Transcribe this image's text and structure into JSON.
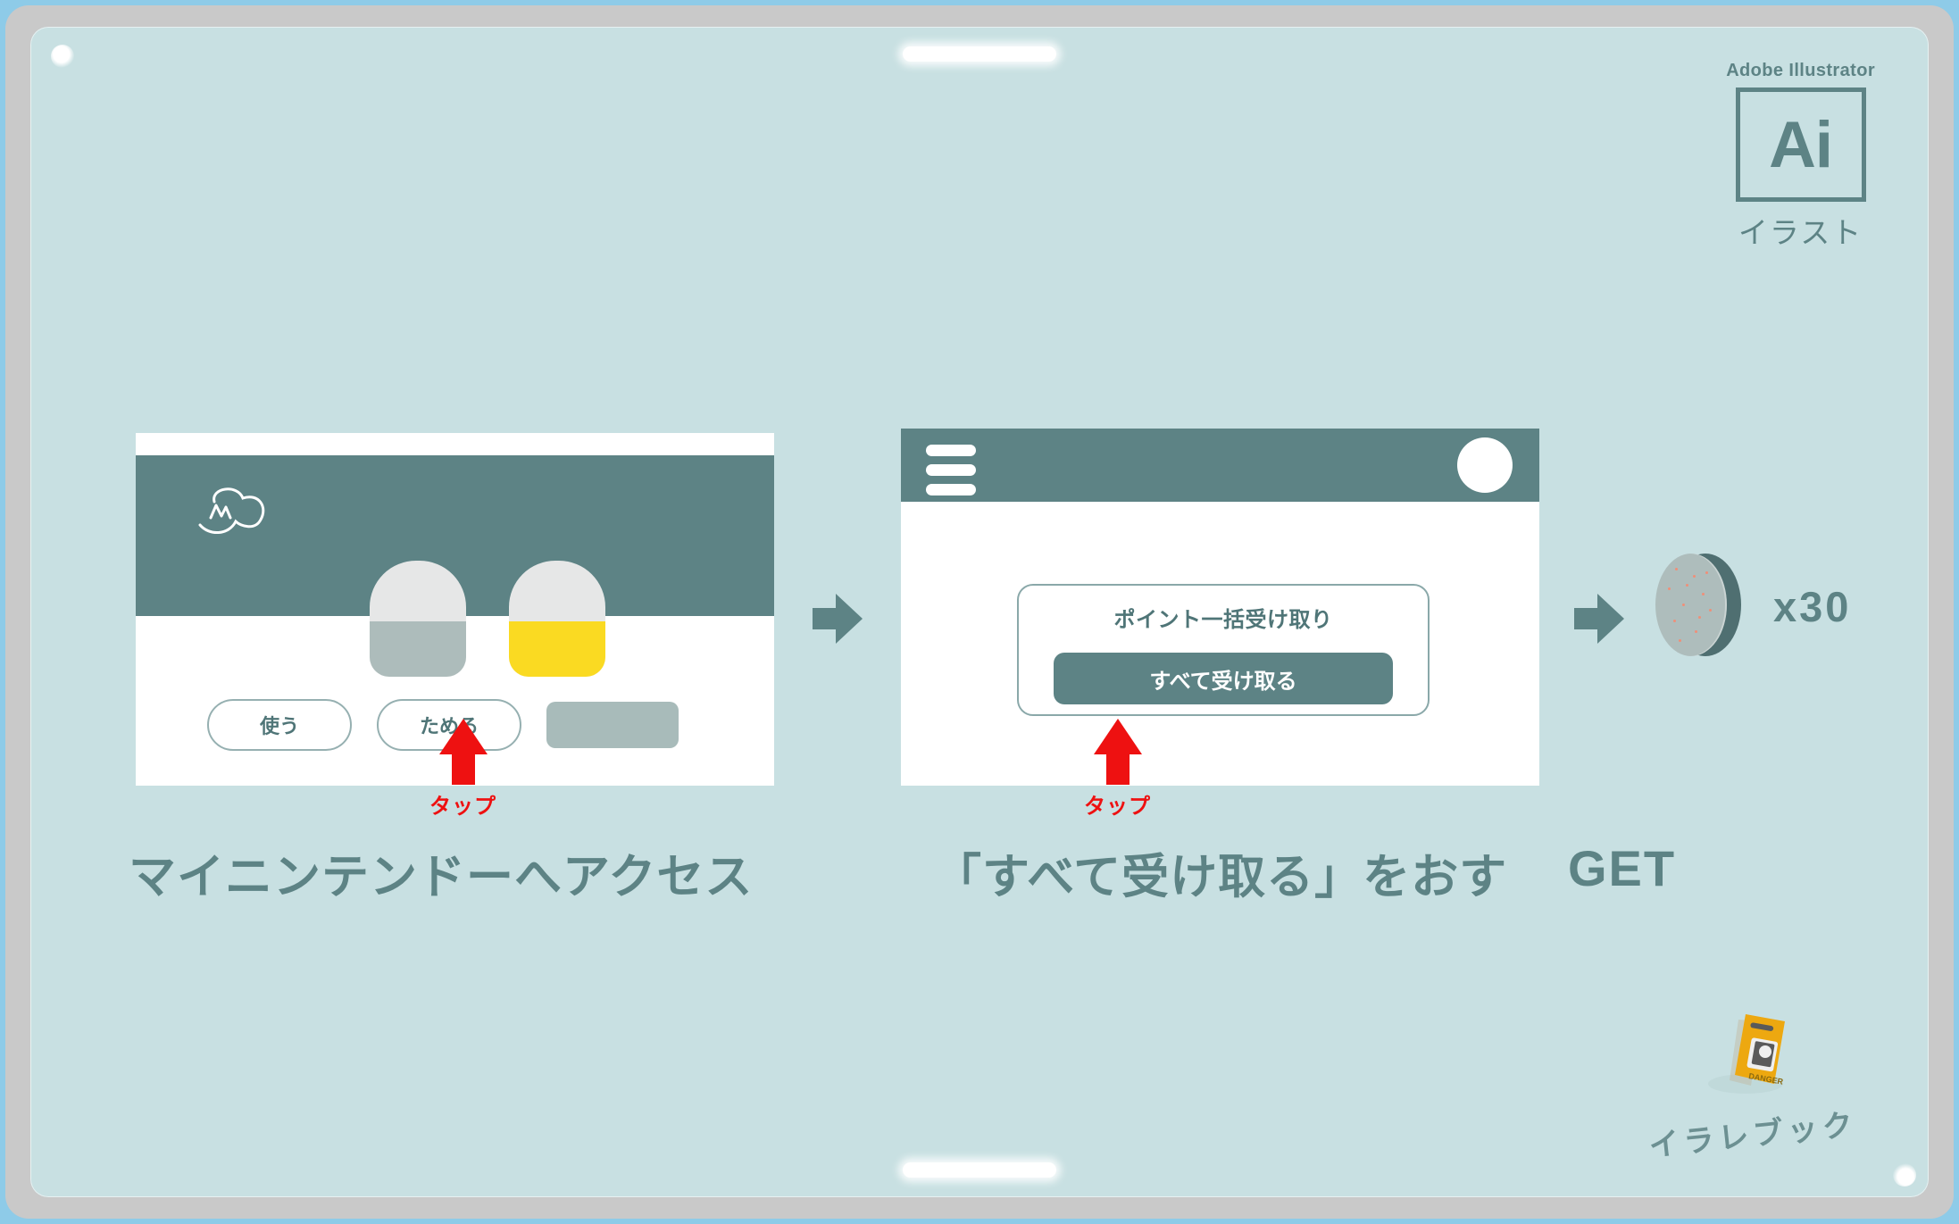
{
  "badge": {
    "app_name": "Adobe Illustrator",
    "glyph": "Ai",
    "subtitle": "イラスト",
    "icon": "ai-logo-icon",
    "color": "#5d8385"
  },
  "theme": {
    "background": "#c8e0e2",
    "teal": "#5d8385",
    "teal_dark": "#4f7577",
    "red": "#ee1111",
    "yellow": "#fada22",
    "gray": "#aebdbc",
    "frame_gray": "#c9c9c9",
    "frame_blue": "#8ecbe8",
    "white": "#ffffff"
  },
  "steps": [
    {
      "index": 1,
      "caption": "マイニンテンドーへアクセス",
      "phone": {
        "logo_icon": "cloud-mascot-icon",
        "capsules": [
          {
            "name": "capsule-gray",
            "fill_color": "#adbcbb"
          },
          {
            "name": "capsule-yellow",
            "fill_color": "#fada22"
          }
        ],
        "buttons": [
          {
            "label": "使う",
            "name": "use-points-button"
          },
          {
            "label": "ためる",
            "name": "earn-points-button"
          }
        ],
        "placeholder_block": "block-placeholder"
      },
      "tap": {
        "label": "タップ",
        "target": "ためる"
      }
    },
    {
      "index": 2,
      "caption": "「すべて受け取る」をおす",
      "phone": {
        "menu_icon": "hamburger-menu-icon",
        "avatar_icon": "account-avatar-icon",
        "card": {
          "title": "ポイント一括受け取り",
          "button_label": "すべて受け取る"
        }
      },
      "tap": {
        "label": "タップ",
        "target": "すべて受け取る"
      }
    },
    {
      "index": 3,
      "caption": "GET",
      "reward": {
        "icon": "coin-icon",
        "count_label": "x30"
      }
    }
  ],
  "arrows": [
    {
      "name": "flow-arrow-1",
      "direction": "right"
    },
    {
      "name": "flow-arrow-2",
      "direction": "right"
    }
  ],
  "watermark": {
    "text": "イラレブック",
    "icon": "caution-sign-icon",
    "sign_label": "DANGER"
  }
}
